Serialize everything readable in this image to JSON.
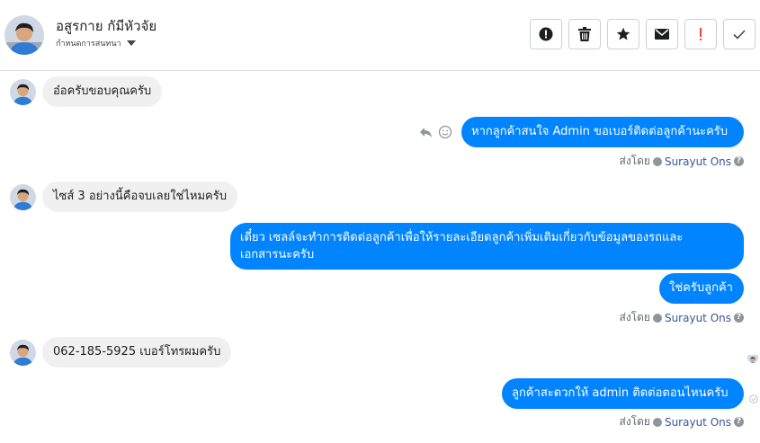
{
  "header": {
    "contact_name": "อสูรกาย กัมีหัวจัย",
    "subtitle": "กำหนดการสนทนา"
  },
  "toolbar": [
    "report-icon",
    "delete-icon",
    "star-icon",
    "email-icon",
    "flag-icon",
    "check-icon"
  ],
  "colors": {
    "accent": "#0084ff",
    "incoming_bg": "#f1f0f0",
    "exclamation": "#fa3e3e"
  },
  "messages": [
    {
      "dir": "in",
      "text": "อ๋อครับขอบคุณครับ"
    },
    {
      "dir": "out",
      "text": "หากลูกค้าสนใจ Admin ขอเบอร์ติดต่อลูกค้านะครับ"
    },
    {
      "dir": "in",
      "text": "ไซส์ 3 อย่างนี้คือจบเลยใช่ไหมครับ"
    },
    {
      "dir": "out",
      "line1": "เดี๋ยว เซลล์จะทำการติดต่อลูกค้าเพื่อให้รายละเอียดลูกค้าเพิ่มเติมเกี่ยวกับข้อมูลของรถและ",
      "line2": "เอกสารนะครับ"
    },
    {
      "dir": "out",
      "text": "ใช่ครับลูกค้า"
    },
    {
      "dir": "in",
      "text": "062-185-5925 เบอร์โทรผมครับ"
    },
    {
      "dir": "out",
      "text": "ลูกค้าสะดวกให้ admin ติดต่อตอนไหนครับ"
    }
  ],
  "sent_by": {
    "label": "ส่งโดย",
    "name": "Surayut Ons"
  }
}
